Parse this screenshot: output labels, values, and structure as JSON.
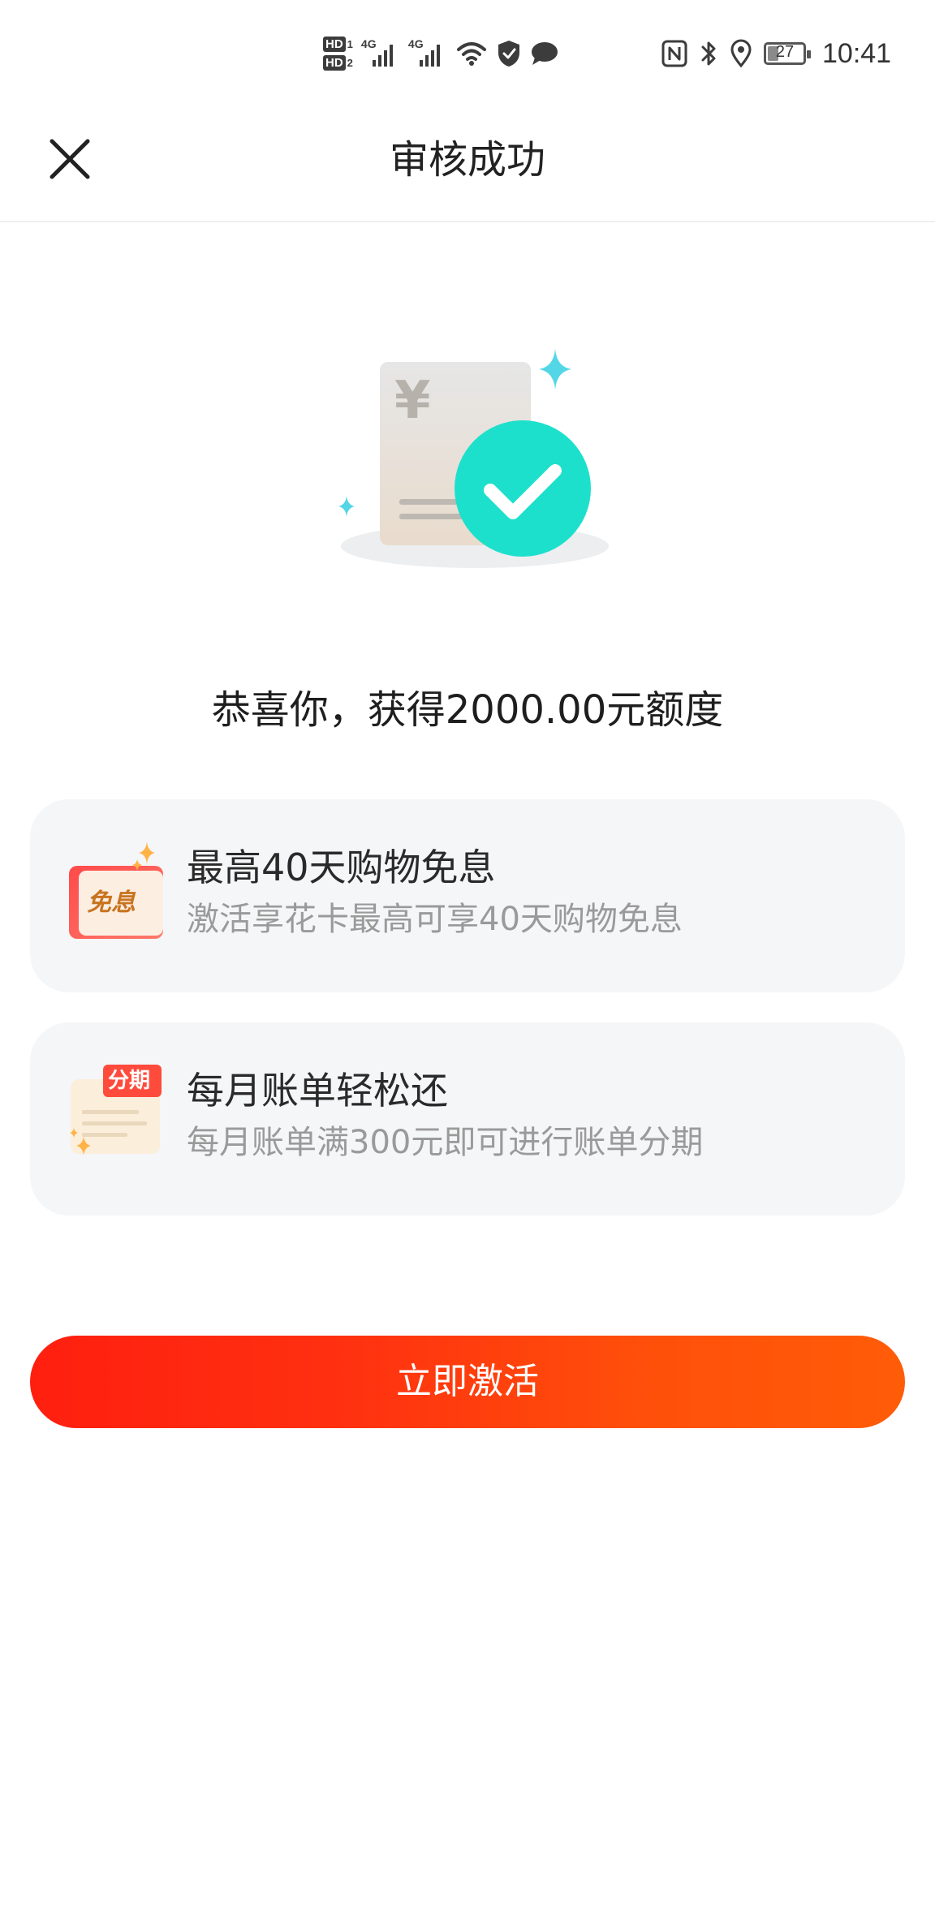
{
  "status_bar": {
    "hd_1_label": "HD",
    "hd_1_num": "1",
    "hd_2_label": "HD",
    "hd_2_num": "2",
    "signal_1_label": "4G",
    "signal_2_label": "4G",
    "battery_level": "27",
    "time": "10:41"
  },
  "nav": {
    "title": "审核成功"
  },
  "hero": {
    "currency_symbol": "¥"
  },
  "headline": "恭喜你，获得2000.00元额度",
  "benefits": [
    {
      "icon_text": "免息",
      "title": "最高40天购物免息",
      "desc": "激活享花卡最高可享40天购物免息"
    },
    {
      "icon_text": "分期",
      "title": "每月账单轻松还",
      "desc": "每月账单满300元即可进行账单分期"
    }
  ],
  "cta": {
    "label": "立即激活"
  },
  "colors": {
    "accent_red": "#ff1f0f",
    "accent_orange": "#ff5c08",
    "check_teal": "#1de0cc",
    "card_bg": "#f5f6f8"
  },
  "icons": [
    "hd-icon",
    "signal-icon",
    "wifi-icon",
    "shield-icon",
    "chat-icon",
    "nfc-icon",
    "bluetooth-icon",
    "location-icon",
    "battery-icon",
    "close-icon",
    "check-icon",
    "sparkle-icon"
  ]
}
